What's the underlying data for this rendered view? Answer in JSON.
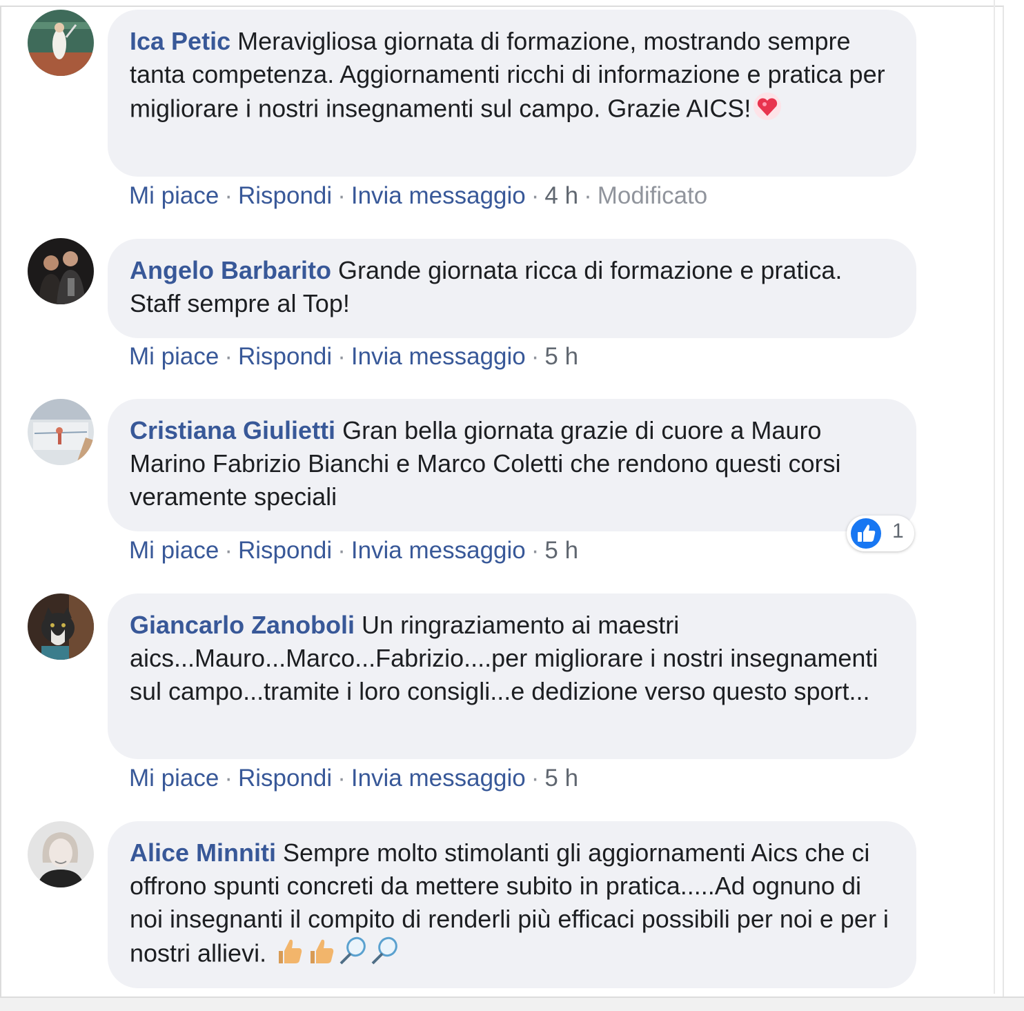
{
  "comments": [
    {
      "author": "Ica Petic",
      "text": "Meravigliosa giornata di formazione, mostrando sempre tanta competenza. Aggiornamenti ricchi di informazione e pratica per migliorare i nostri insegnamenti sul campo. Grazie AICS!",
      "actions": {
        "like": "Mi piace",
        "reply": "Rispondi",
        "message": "Invia messaggio",
        "time": "4 h",
        "edited": "Modificato"
      },
      "trailing_emoji": [
        "sparkling-heart"
      ]
    },
    {
      "author": "Angelo Barbarito",
      "text": "Grande giornata ricca di formazione e pratica. Staff sempre al Top!",
      "actions": {
        "like": "Mi piace",
        "reply": "Rispondi",
        "message": "Invia messaggio",
        "time": "5 h"
      }
    },
    {
      "author": "Cristiana Giulietti",
      "text": "Gran bella giornata grazie di cuore a Mauro Marino Fabrizio Bianchi e Marco Coletti che rendono questi corsi veramente speciali",
      "actions": {
        "like": "Mi piace",
        "reply": "Rispondi",
        "message": "Invia messaggio",
        "time": "5 h"
      },
      "reaction": {
        "icon": "thumbs-up-icon",
        "count": "1"
      }
    },
    {
      "author": "Giancarlo Zanoboli",
      "text": "Un ringraziamento ai maestri aics...Mauro...Marco...Fabrizio....per migliorare i nostri insegnamenti sul campo...tramite i loro consigli...e dedizione verso questo sport...",
      "actions": {
        "like": "Mi piace",
        "reply": "Rispondi",
        "message": "Invia messaggio",
        "time": "5 h"
      }
    },
    {
      "author": "Alice Minniti",
      "text": "Sempre molto stimolanti gli aggiornamenti Aics che ci offrono spunti concreti da mettere subito in pratica.....Ad ognuno di noi insegnanti il compito di renderli più efficaci possibili per noi e per i nostri allievi.",
      "trailing_emoji": [
        "thumbs-up",
        "thumbs-up",
        "tennis-racket",
        "tennis-racket"
      ]
    }
  ],
  "separator": "·",
  "colors": {
    "link": "#385898",
    "bubble": "#f0f1f5",
    "like_blue": "#1877f2"
  }
}
